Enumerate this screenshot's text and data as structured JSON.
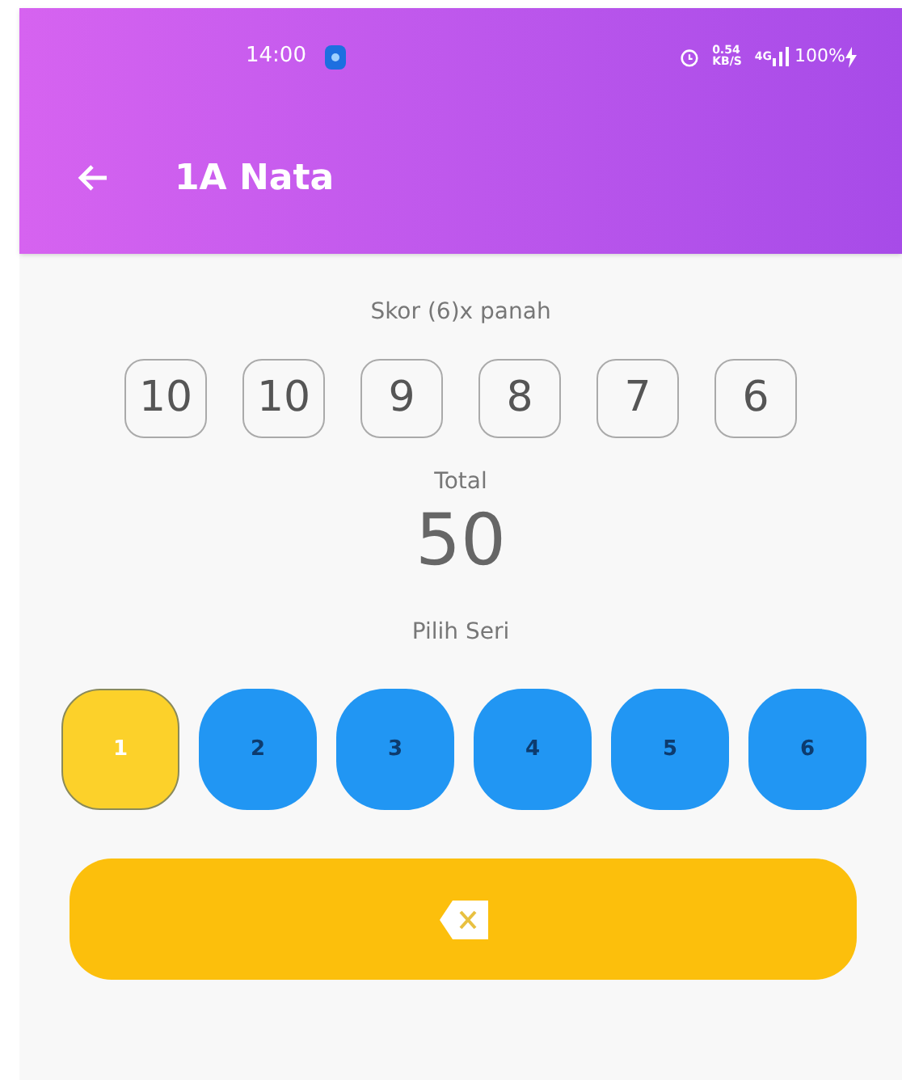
{
  "status_bar": {
    "time": "14:00",
    "net_speed": "0.54",
    "net_unit": "KB/S",
    "network": "4G",
    "battery": "100%"
  },
  "app_bar": {
    "title": "1A Nata"
  },
  "scores": {
    "label": "Skor (6)x panah",
    "values": [
      "10",
      "10",
      "9",
      "8",
      "7",
      "6"
    ]
  },
  "total": {
    "label": "Total",
    "value": "50"
  },
  "series": {
    "label": "Pilih Seri",
    "items": [
      {
        "label": "1",
        "selected": true
      },
      {
        "label": "2",
        "selected": false
      },
      {
        "label": "3",
        "selected": false
      },
      {
        "label": "4",
        "selected": false
      },
      {
        "label": "5",
        "selected": false
      },
      {
        "label": "6",
        "selected": false
      }
    ]
  }
}
